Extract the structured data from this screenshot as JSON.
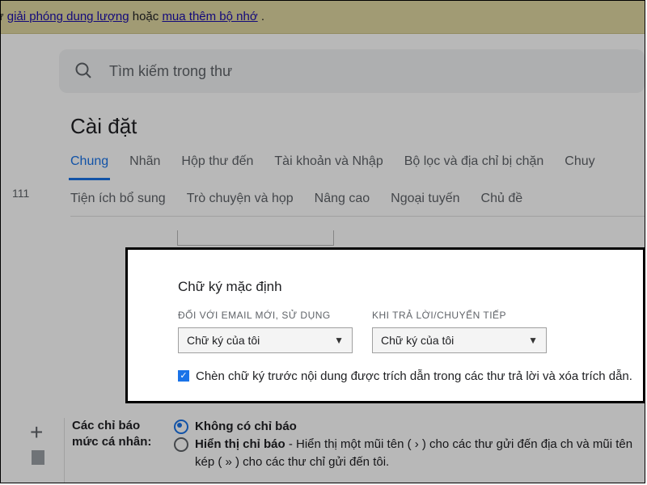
{
  "banner": {
    "prefix_frag": "ờ. Hãy thử ",
    "link1": "giải phóng dung lượng",
    "mid": " hoặc ",
    "link2": "mua thêm bộ nhớ",
    "suffix": "."
  },
  "search": {
    "placeholder": "Tìm kiếm trong thư"
  },
  "title": "Cài đặt",
  "tabs_row1": [
    "Chung",
    "Nhãn",
    "Hộp thư đến",
    "Tài khoản và Nhập",
    "Bộ lọc và địa chỉ bị chặn",
    "Chuy"
  ],
  "tabs_row2": [
    "Tiện ích bổ sung",
    "Trò chuyện và họp",
    "Nâng cao",
    "Ngoại tuyến",
    "Chủ đề"
  ],
  "active_tab_index": 0,
  "sidebar": {
    "count111": "111",
    "plus": "+"
  },
  "popup": {
    "title": "Chữ ký mặc định",
    "col1_label": "ĐỐI VỚI EMAIL MỚI, SỬ DỤNG",
    "col2_label": "KHI TRẢ LỜI/CHUYỂN TIẾP",
    "select1_value": "Chữ ký của tôi",
    "select2_value": "Chữ ký của tôi",
    "checkbox_checked": true,
    "checkbox_text": "Chèn chữ ký trước nội dung được trích dẫn trong các thư trả lời và xóa trích dẫn."
  },
  "indicators": {
    "label_line1": "Các chỉ báo",
    "label_line2": "mức cá nhân:",
    "opt1_label": "Không có chỉ báo",
    "opt2_label": "Hiển thị chỉ báo",
    "opt2_desc_frag": " - Hiển thị một mũi tên ( › ) cho các thư gửi đến địa ch và mũi tên kép ( » ) cho các thư chỉ gửi đến tôi.",
    "selected": 0
  }
}
